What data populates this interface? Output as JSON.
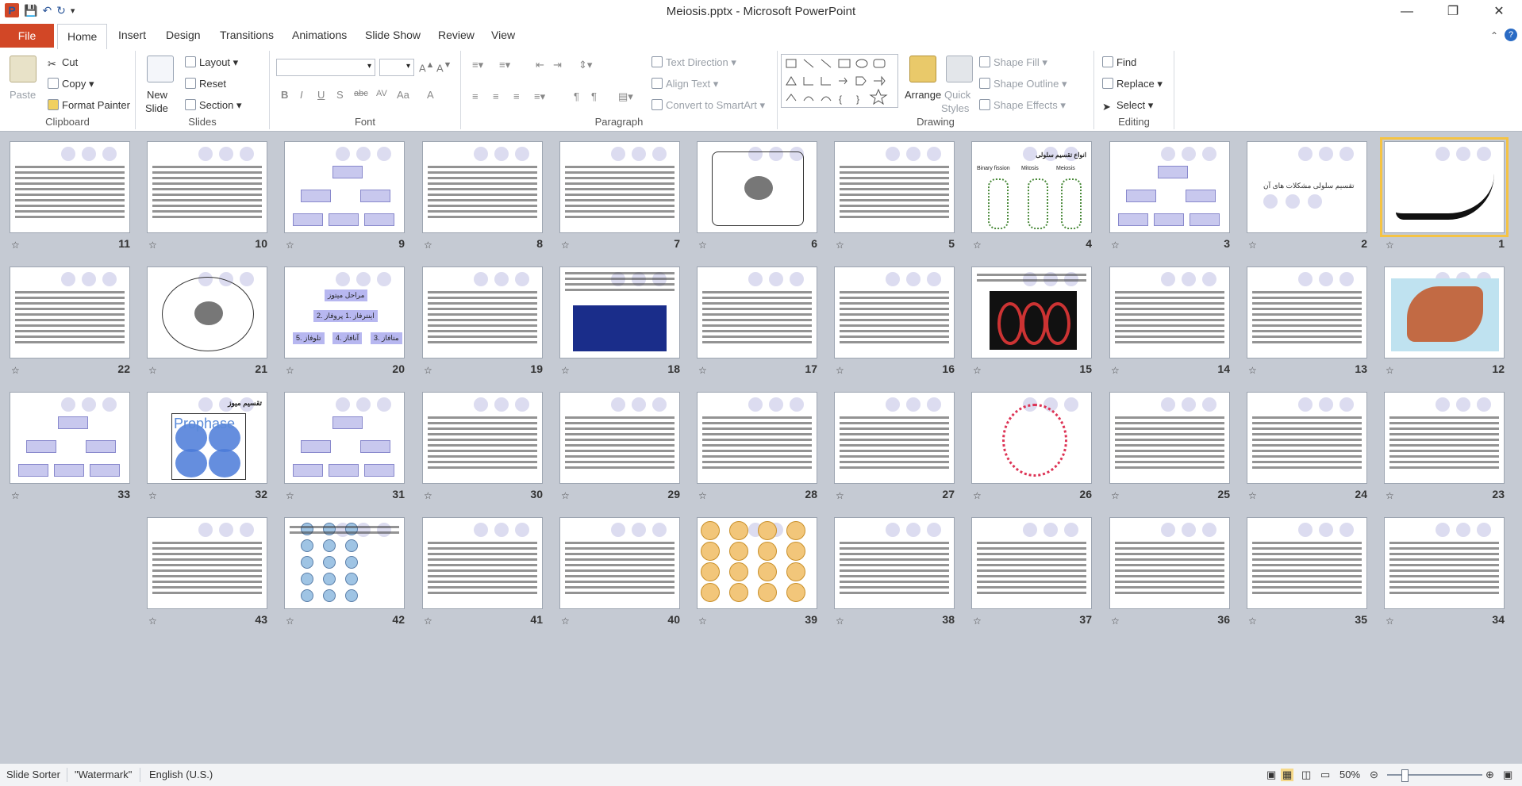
{
  "window": {
    "title": "Meiosis.pptx  -  Microsoft PowerPoint"
  },
  "tabs": {
    "file": "File",
    "home": "Home",
    "insert": "Insert",
    "design": "Design",
    "transitions": "Transitions",
    "animations": "Animations",
    "slideshow": "Slide Show",
    "review": "Review",
    "view": "View"
  },
  "ribbon": {
    "clipboard": {
      "label": "Clipboard",
      "paste": "Paste",
      "cut": "Cut",
      "copy": "Copy",
      "format_painter": "Format Painter"
    },
    "slides": {
      "label": "Slides",
      "new_slide": "New",
      "new_slide2": "Slide",
      "layout": "Layout",
      "reset": "Reset",
      "section": "Section"
    },
    "font": {
      "label": "Font"
    },
    "paragraph": {
      "label": "Paragraph",
      "text_direction": "Text Direction",
      "align_text": "Align Text",
      "convert_smartart": "Convert to SmartArt"
    },
    "drawing": {
      "label": "Drawing",
      "arrange": "Arrange",
      "quick_styles": "Quick",
      "quick_styles2": "Styles",
      "shape_fill": "Shape Fill",
      "shape_outline": "Shape Outline",
      "shape_effects": "Shape Effects"
    },
    "editing": {
      "label": "Editing",
      "find": "Find",
      "replace": "Replace",
      "select": "Select"
    }
  },
  "slides": [
    {
      "num": "1",
      "kind": "calligraphy",
      "selected": true
    },
    {
      "num": "2",
      "kind": "title",
      "text": "تقسیم سلولی مشکلات های آن"
    },
    {
      "num": "3",
      "kind": "diagram"
    },
    {
      "num": "4",
      "kind": "fission"
    },
    {
      "num": "5",
      "kind": "text"
    },
    {
      "num": "6",
      "kind": "cell"
    },
    {
      "num": "7",
      "kind": "text"
    },
    {
      "num": "8",
      "kind": "text"
    },
    {
      "num": "9",
      "kind": "diagram"
    },
    {
      "num": "10",
      "kind": "text"
    },
    {
      "num": "11",
      "kind": "text"
    },
    {
      "num": "12",
      "kind": "dna"
    },
    {
      "num": "13",
      "kind": "text"
    },
    {
      "num": "14",
      "kind": "text"
    },
    {
      "num": "15",
      "kind": "dark"
    },
    {
      "num": "16",
      "kind": "text"
    },
    {
      "num": "17",
      "kind": "text"
    },
    {
      "num": "18",
      "kind": "blue"
    },
    {
      "num": "19",
      "kind": "text"
    },
    {
      "num": "20",
      "kind": "phases"
    },
    {
      "num": "21",
      "kind": "cell2"
    },
    {
      "num": "22",
      "kind": "text"
    },
    {
      "num": "23",
      "kind": "text"
    },
    {
      "num": "24",
      "kind": "text"
    },
    {
      "num": "25",
      "kind": "text"
    },
    {
      "num": "26",
      "kind": "cycle"
    },
    {
      "num": "27",
      "kind": "text"
    },
    {
      "num": "28",
      "kind": "text"
    },
    {
      "num": "29",
      "kind": "text"
    },
    {
      "num": "30",
      "kind": "text"
    },
    {
      "num": "31",
      "kind": "diagram"
    },
    {
      "num": "32",
      "kind": "prophase",
      "text": "Prophase"
    },
    {
      "num": "33",
      "kind": "tree"
    },
    {
      "num": "34",
      "kind": "text"
    },
    {
      "num": "35",
      "kind": "text"
    },
    {
      "num": "36",
      "kind": "text"
    },
    {
      "num": "37",
      "kind": "text"
    },
    {
      "num": "38",
      "kind": "text"
    },
    {
      "num": "39",
      "kind": "meiosis"
    },
    {
      "num": "40",
      "kind": "text"
    },
    {
      "num": "41",
      "kind": "text"
    },
    {
      "num": "42",
      "kind": "stages"
    },
    {
      "num": "43",
      "kind": "text"
    }
  ],
  "slide_texts": {
    "s20_title": "مراحل میتوز",
    "s20_a": "1. اینترفاز",
    "s20_b": "2. پروفاز",
    "s20_c": "3. متافاز",
    "s20_d": "4. آنافاز",
    "s20_e": "5. تلوفاز",
    "s4_title": "انواع تقسیم سلولی",
    "s4_a": "Binary fission",
    "s4_b": "Mitosis",
    "s4_c": "Meiosis",
    "s32_title": "تقسیم میوز"
  },
  "statusbar": {
    "view": "Slide Sorter",
    "theme": "\"Watermark\"",
    "language": "English (U.S.)",
    "zoom": "50%"
  }
}
